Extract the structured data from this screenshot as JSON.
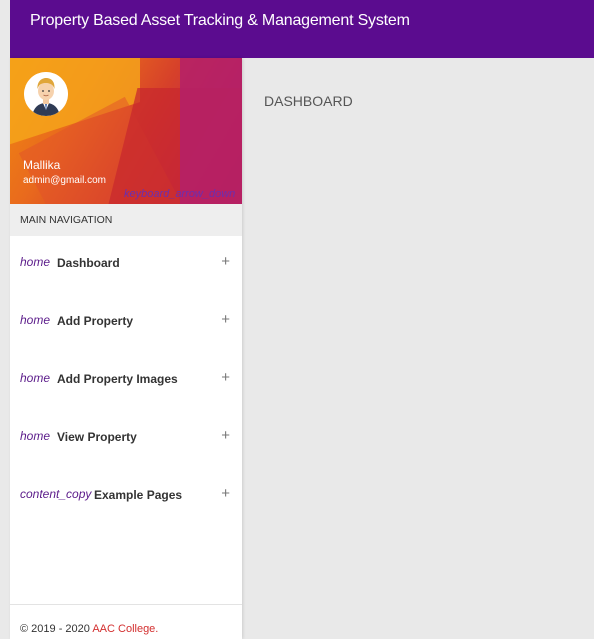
{
  "header": {
    "title": "Property Based Asset Tracking & Management System"
  },
  "user": {
    "name": "Mallika",
    "email": "admin@gmail.com",
    "menu_icon": "keyboard_arrow_down"
  },
  "sidebar": {
    "header": "MAIN NAVIGATION",
    "items": [
      {
        "icon": "home",
        "label": "Dashboard",
        "expand": "+"
      },
      {
        "icon": "home",
        "label": "Add Property",
        "expand": "+"
      },
      {
        "icon": "home",
        "label": "Add Property Images",
        "expand": "+"
      },
      {
        "icon": "home",
        "label": "View Property",
        "expand": "+"
      },
      {
        "icon": "content_copy",
        "label": "Example Pages",
        "expand": "+"
      }
    ]
  },
  "footer": {
    "copyright": "© 2019 - 2020 ",
    "college": "AAC College."
  },
  "content": {
    "title": "DASHBOARD"
  },
  "colors": {
    "topbar": "#5b0c8f",
    "icon": "#5b1b8a",
    "college": "#d32f2f"
  }
}
